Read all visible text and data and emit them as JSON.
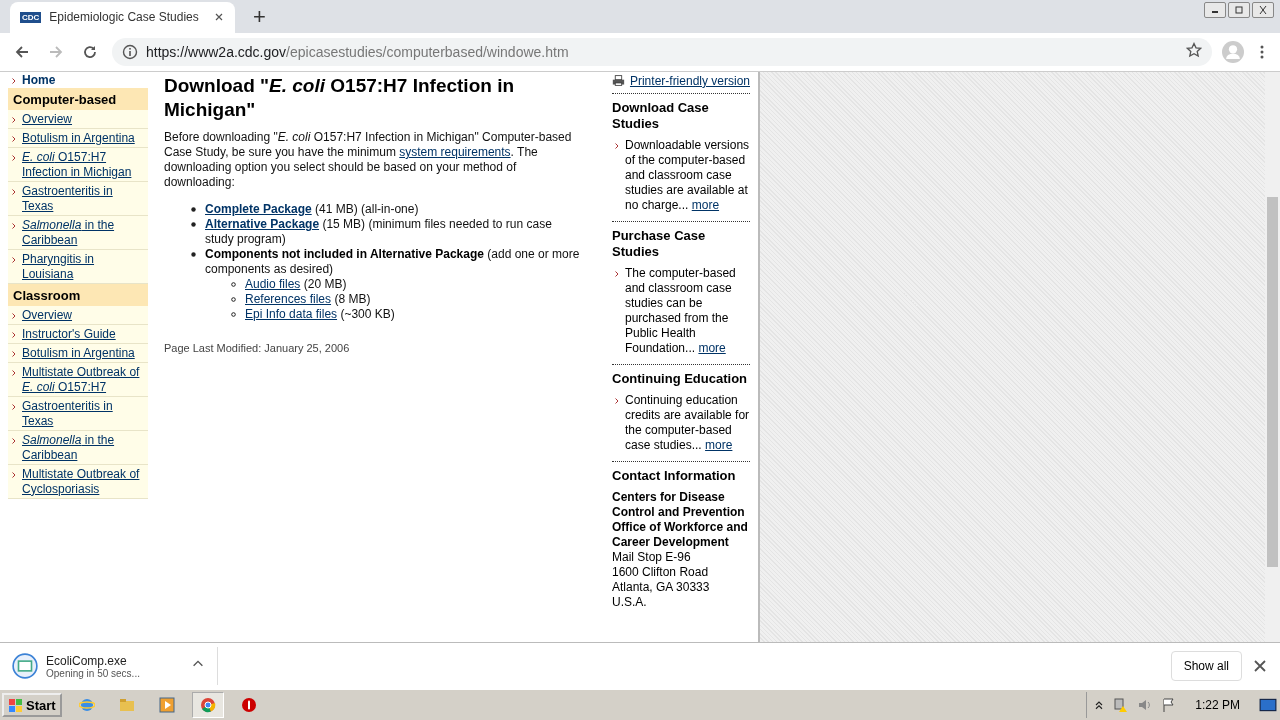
{
  "browser": {
    "tab": {
      "title": "Epidemiologic Case Studies",
      "favicon": "CDC"
    },
    "new_tab": "+",
    "url": {
      "domain": "https://www2a.cdc.gov",
      "path": "/epicasestudies/computerbased/windowe.htm"
    }
  },
  "nav": [
    {
      "kind": "home",
      "text": "Home"
    },
    {
      "kind": "header",
      "text": "Computer-based"
    },
    {
      "kind": "link",
      "text": "Overview"
    },
    {
      "kind": "link",
      "text": "Botulism in Argentina"
    },
    {
      "kind": "link",
      "text": "*E. coli* O157:H7 Infection in Michigan"
    },
    {
      "kind": "link",
      "text": "Gastroenteritis in Texas"
    },
    {
      "kind": "link",
      "text": "*Salmonella* in the Caribbean"
    },
    {
      "kind": "link",
      "text": "Pharyngitis in Louisiana"
    },
    {
      "kind": "header",
      "text": "Classroom"
    },
    {
      "kind": "link",
      "text": "Overview"
    },
    {
      "kind": "link",
      "text": "Instructor's Guide"
    },
    {
      "kind": "link",
      "text": "Botulism in Argentina"
    },
    {
      "kind": "link",
      "text": "Multistate Outbreak of *E. coli* O157:H7"
    },
    {
      "kind": "link",
      "text": "Gastroenteritis in Texas"
    },
    {
      "kind": "link",
      "text": "*Salmonella* in the Caribbean"
    },
    {
      "kind": "link",
      "text": "Multistate Outbreak of Cyclosporiasis"
    }
  ],
  "main": {
    "title": "Download \"*E. coli* O157:H7 Infection in Michigan\"",
    "intro": {
      "before": "Before downloading \"*E. coli* O157:H7 Infection in Michigan\" Computer-based Case Study, be sure you have the minimum ",
      "link": "system requirements",
      "after": ". The downloading option you select should be based on your method of downloading:"
    },
    "options": [
      {
        "kind": "link",
        "label": "Complete Package",
        "note": "(41 MB) (all-in-one)"
      },
      {
        "kind": "link",
        "label": "Alternative Package",
        "note": "(15 MB) (minimum files needed to run case study program)"
      },
      {
        "kind": "heading",
        "label": "Components not included in Alternative Package",
        "note": "(add one or more components as desired)",
        "children": [
          {
            "label": "Audio files",
            "note": "(20 MB)"
          },
          {
            "label": "References files",
            "note": "(8 MB)"
          },
          {
            "label": "Epi Info data files",
            "note": "(~300 KB)"
          }
        ]
      }
    ],
    "modified": "Page Last Modified: January 25, 2006"
  },
  "side": {
    "printer": "Printer-friendly version",
    "sections": [
      {
        "title": "Download Case Studies",
        "body": "Downloadable versions of the computer-based and classroom case studies are available at no charge...",
        "more": "more"
      },
      {
        "title": "Purchase Case Studies",
        "body": "The computer-based and classroom case studies can be purchased from the Public Health Foundation...",
        "more": "more"
      },
      {
        "title": "Continuing Education",
        "body": "Continuing education credits are available for the computer-based case studies...",
        "more": "more"
      }
    ],
    "contact": {
      "title": "Contact Information",
      "org": "Centers for Disease Control and Prevention Office of Workforce and Career Development",
      "lines": [
        "Mail Stop E-96",
        "1600 Clifton Road",
        "Atlanta, GA 30333",
        "U.S.A."
      ]
    }
  },
  "download": {
    "file": "EcoliComp.exe",
    "status": "Opening in 50 secs...",
    "show_all": "Show all"
  },
  "taskbar": {
    "start": "Start",
    "time": "1:22 PM"
  }
}
